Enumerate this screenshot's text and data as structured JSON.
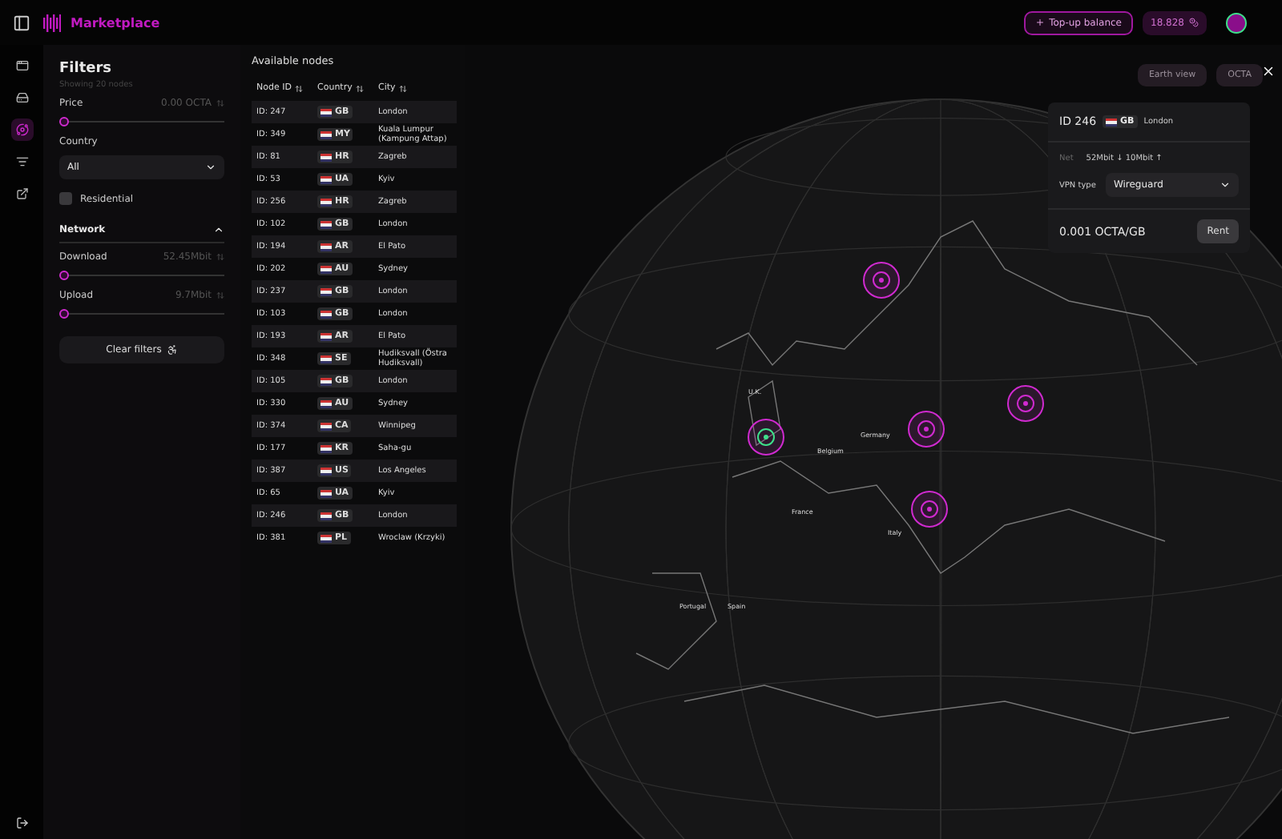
{
  "app": {
    "title": "Marketplace"
  },
  "header": {
    "topup": "Top-up balance",
    "balance": "18.828"
  },
  "rail": [
    {
      "kind": "window",
      "selected": false
    },
    {
      "kind": "server",
      "selected": false
    },
    {
      "kind": "planet",
      "selected": true
    },
    {
      "kind": "list",
      "selected": false
    },
    {
      "kind": "external",
      "selected": false
    }
  ],
  "filters": {
    "title": "Filters",
    "subtitle": "Showing 20 nodes",
    "price": {
      "label": "Price",
      "value": "0.00 OCTA",
      "level": 0
    },
    "country": {
      "label": "Country",
      "value": "All"
    },
    "residential": {
      "label": "Residential",
      "checked": false
    },
    "network": {
      "label": "Network",
      "expanded": true,
      "sliders": [
        {
          "label": "Download",
          "value": "52.45Mbit",
          "level": 0
        },
        {
          "label": "Upload",
          "value": "9.7Mbit",
          "level": 0
        }
      ]
    },
    "clear": "Clear filters"
  },
  "nodes": {
    "title": "Available nodes",
    "columns": [
      "Node ID",
      "Country",
      "City"
    ],
    "rows": [
      {
        "id": "ID: 247",
        "country": "GB",
        "city": "London"
      },
      {
        "id": "ID: 349",
        "country": "MY",
        "city": "Kuala Lumpur (Kampung Attap)"
      },
      {
        "id": "ID: 81",
        "country": "HR",
        "city": "Zagreb"
      },
      {
        "id": "ID: 53",
        "country": "UA",
        "city": "Kyiv"
      },
      {
        "id": "ID: 256",
        "country": "HR",
        "city": "Zagreb"
      },
      {
        "id": "ID: 102",
        "country": "GB",
        "city": "London"
      },
      {
        "id": "ID: 194",
        "country": "AR",
        "city": "El Pato"
      },
      {
        "id": "ID: 202",
        "country": "AU",
        "city": "Sydney"
      },
      {
        "id": "ID: 237",
        "country": "GB",
        "city": "London"
      },
      {
        "id": "ID: 103",
        "country": "GB",
        "city": "London"
      },
      {
        "id": "ID: 193",
        "country": "AR",
        "city": "El Pato"
      },
      {
        "id": "ID: 348",
        "country": "SE",
        "city": "Hudiksvall (Östra Hudiksvall)"
      },
      {
        "id": "ID: 105",
        "country": "GB",
        "city": "London"
      },
      {
        "id": "ID: 330",
        "country": "AU",
        "city": "Sydney"
      },
      {
        "id": "ID: 374",
        "country": "CA",
        "city": "Winnipeg"
      },
      {
        "id": "ID: 177",
        "country": "KR",
        "city": "Saha-gu"
      },
      {
        "id": "ID: 387",
        "country": "US",
        "city": "Los Angeles"
      },
      {
        "id": "ID: 65",
        "country": "UA",
        "city": "Kyiv"
      },
      {
        "id": "ID: 246",
        "country": "GB",
        "city": "London"
      },
      {
        "id": "ID: 381",
        "country": "PL",
        "city": "Wroclaw (Krzyki)"
      }
    ]
  },
  "map": {
    "view_buttons": [
      "Earth view",
      "OCTA"
    ],
    "labels": [
      "U.K.",
      "Belgium",
      "Germany",
      "France",
      "Italy",
      "Portugal",
      "Spain"
    ],
    "markers": [
      {
        "selected": true
      },
      {
        "selected": false
      },
      {
        "selected": false
      },
      {
        "selected": false
      },
      {
        "selected": false
      }
    ]
  },
  "popup": {
    "id": "ID 246",
    "country": "GB",
    "city": "London",
    "net_label": "Net",
    "net": "52Mbit ↓ 10Mbit ↑",
    "vpn_label": "VPN type",
    "vpn": "Wireguard",
    "price": "0.001 OCTA/GB",
    "rent": "Rent"
  }
}
